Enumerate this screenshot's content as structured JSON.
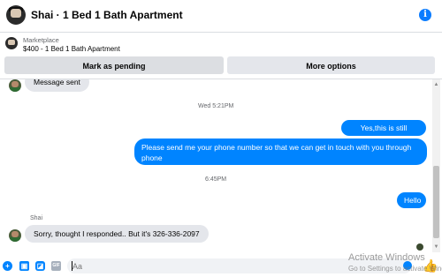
{
  "header": {
    "title": "Shai · 1 Bed 1 Bath Apartment",
    "info_icon": "info-icon"
  },
  "marketplace": {
    "label": "Marketplace",
    "listing": "$400 - 1 Bed 1 Bath Apartment",
    "pending_button": "Mark as pending",
    "options_button": "More options"
  },
  "conversation": {
    "messages": [
      {
        "direction": "in",
        "text": "Message sent"
      },
      {
        "type": "timestamp",
        "text": "Wed 5:21PM"
      },
      {
        "direction": "out",
        "text": "Yes,this is still available"
      },
      {
        "direction": "out",
        "text": "Please send me your phone  number so that we can get in touch with you through phone"
      },
      {
        "type": "timestamp",
        "text": "6:45PM"
      },
      {
        "direction": "out",
        "text": "Hello"
      },
      {
        "sender": "Shai",
        "direction": "in",
        "text": "Sorry, thought I responded.. But it's 326-336-2097"
      }
    ]
  },
  "composer": {
    "placeholder": "Aa"
  },
  "watermark": {
    "title": "Activate Windows",
    "subtitle": "Go to Settings to activate Windows."
  },
  "colors": {
    "accent": "#0084ff",
    "incoming_bubble": "#e4e6eb"
  }
}
